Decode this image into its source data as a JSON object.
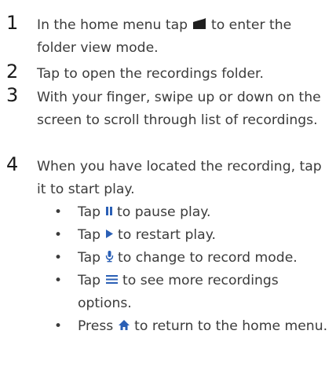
{
  "steps": [
    {
      "number": "1",
      "text_before": "In the home menu tap ",
      "icon": "folder-icon",
      "text_after": " to enter the folder view mode."
    },
    {
      "number": "2",
      "text": "Tap to open the recordings folder."
    },
    {
      "number": "3",
      "text": "With your finger, swipe up or down on the screen to scroll through list of recordings."
    },
    {
      "number": "4",
      "text": "When you have located the recording, tap it to start play."
    }
  ],
  "bullets": [
    {
      "symbol": "•",
      "before": "Tap ",
      "icon": "pause-icon",
      "after": " to pause play."
    },
    {
      "symbol": "•",
      "before": "Tap ",
      "icon": "play-icon",
      "after": " to restart play."
    },
    {
      "symbol": "•",
      "before": "Tap ",
      "icon": "microphone-icon",
      "after": " to change to record mode."
    },
    {
      "symbol": "•",
      "before": "Tap ",
      "icon": "menu-icon",
      "after": " to see more recordings options."
    },
    {
      "symbol": "•",
      "before": "Press ",
      "icon": "home-icon",
      "after": " to return to the home menu."
    }
  ],
  "colors": {
    "text": "#3b3b3b",
    "number": "#1a1a1a",
    "icon_accent": "#2a5fb5",
    "icon_dark": "#1f1f1f"
  }
}
